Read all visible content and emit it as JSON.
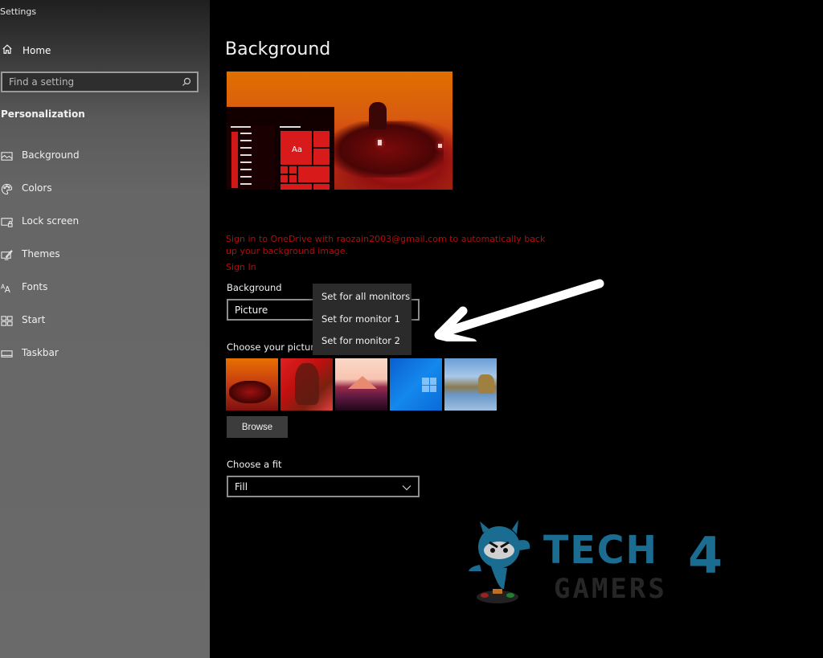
{
  "app": {
    "title": "Settings"
  },
  "sidebar": {
    "home_label": "Home",
    "search": {
      "placeholder": "Find a setting",
      "icon": "search-icon"
    },
    "section_title": "Personalization",
    "items": [
      {
        "label": "Background",
        "icon": "picture-icon"
      },
      {
        "label": "Colors",
        "icon": "palette-icon"
      },
      {
        "label": "Lock screen",
        "icon": "lock-screen-icon"
      },
      {
        "label": "Themes",
        "icon": "themes-icon"
      },
      {
        "label": "Fonts",
        "icon": "fonts-icon"
      },
      {
        "label": "Start",
        "icon": "start-icon"
      },
      {
        "label": "Taskbar",
        "icon": "taskbar-icon"
      }
    ]
  },
  "main": {
    "page_title": "Background",
    "preview": {
      "tile_text": "Aa"
    },
    "onedrive_message": "Sign in to OneDrive with raozain2003@gmail.com to automatically back up your background image.",
    "signin_link": "Sign In",
    "background_label": "Background",
    "background_value": "Picture",
    "context_menu": [
      "Set for all monitors",
      "Set for monitor 1",
      "Set for monitor 2"
    ],
    "choose_picture_label": "Choose your picture",
    "pictures": [
      "Blade Runner orange",
      "Red warrior",
      "Pink mountains",
      "Windows blue",
      "Beach rocks"
    ],
    "browse_label": "Browse",
    "fit_label": "Choose a fit",
    "fit_value": "Fill"
  },
  "watermark": {
    "line1": "TECH",
    "number": "4",
    "line2": "GAMERS"
  },
  "colors": {
    "accent_red": "#b00d0d",
    "tile_red": "#d81a1a",
    "logo_blue": "#1a6c90"
  }
}
